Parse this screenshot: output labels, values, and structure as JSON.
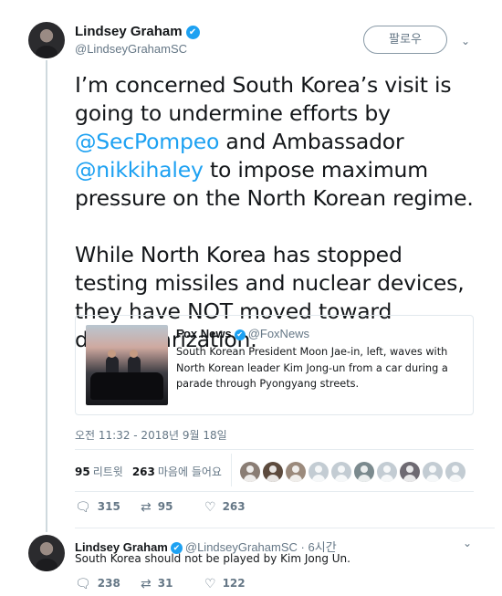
{
  "tweet": {
    "author_name": "Lindsey Graham",
    "author_handle": "@LindseyGrahamSC",
    "verified_glyph": "✔",
    "follow_label": "팔로우",
    "menu_glyph": "⌄",
    "text": {
      "p1_a": "I’m concerned South Korea’s visit is going to undermine efforts by ",
      "mention1": "@SecPompeo",
      "p1_b": " and Ambassador ",
      "mention2": "@nikkihaley",
      "p1_c": " to impose maximum pressure on the North Korean regime.",
      "p2": "While North Korea has stopped testing missiles and nuclear devices, they have NOT moved toward denuclearization."
    },
    "quoted": {
      "name": "Fox News",
      "handle": "@FoxNews",
      "text": "South Korean President Moon Jae-in, left, waves with North Korean leader Kim Jong-un from a car during a parade through Pyongyang streets."
    },
    "timestamp": "오전 11:32 - 2018년 9월 18일",
    "stats": {
      "retweets_count": "95",
      "retweets_label": "리트윗",
      "likes_count": "263",
      "likes_label": "마음에 들어요"
    },
    "liker_count_shown": 10,
    "actions": {
      "reply_count": "315",
      "retweet_count": "95",
      "like_count": "263"
    }
  },
  "reply": {
    "author_name": "Lindsey Graham",
    "author_handle": "@LindseyGrahamSC",
    "separator": "·",
    "time": "6시간",
    "text": "South Korea should not be played by Kim Jong Un.",
    "actions": {
      "reply_count": "238",
      "retweet_count": "31",
      "like_count": "122"
    }
  },
  "icons": {
    "reply": "reply-icon",
    "retweet": "retweet-icon",
    "like": "heart-icon",
    "verified": "verified-badge-icon",
    "menu": "chevron-down-icon"
  },
  "colors": {
    "accent": "#1da1f2",
    "text": "#14171a",
    "muted": "#657786",
    "border": "#e6ecf0"
  }
}
